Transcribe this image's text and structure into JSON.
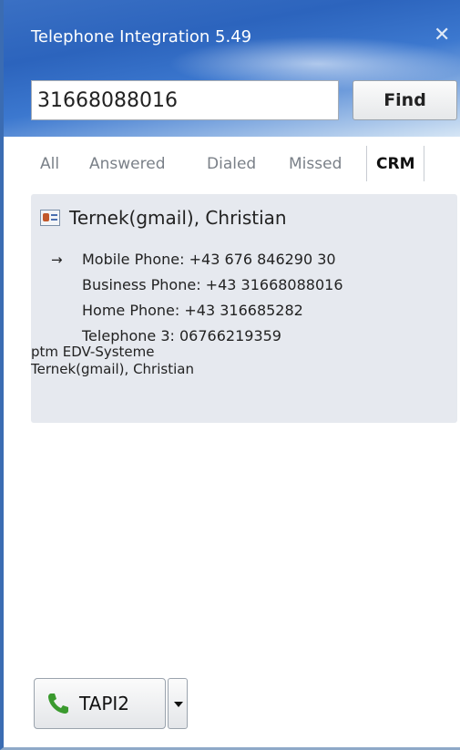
{
  "window": {
    "title": "Telephone Integration 5.49",
    "close_glyph": "✕"
  },
  "search": {
    "value": "31668088016",
    "find_label": "Find"
  },
  "tabs": [
    {
      "label": "All"
    },
    {
      "label": "Answered"
    },
    {
      "label": "Dialed"
    },
    {
      "label": "Missed"
    },
    {
      "label": "CRM",
      "active": true
    }
  ],
  "contact": {
    "icon": "contact-card-icon",
    "name": "Ternek(gmail), Christian",
    "selected_marker": "→",
    "phones": [
      "Mobile Phone: +43 676 846290 30",
      "Business Phone: +43 31668088016",
      "Home Phone: +43 316685282",
      "Telephone 3: 06766219359"
    ],
    "company": "ptm EDV-Systeme",
    "display_name": "Ternek(gmail), Christian"
  },
  "line": {
    "label": "TAPI2",
    "icon": "phone-handset-icon"
  },
  "colors": {
    "titlebar": "#2c64bd",
    "card_bg": "#e6e9ef",
    "phone_icon": "#3a9a2e"
  }
}
